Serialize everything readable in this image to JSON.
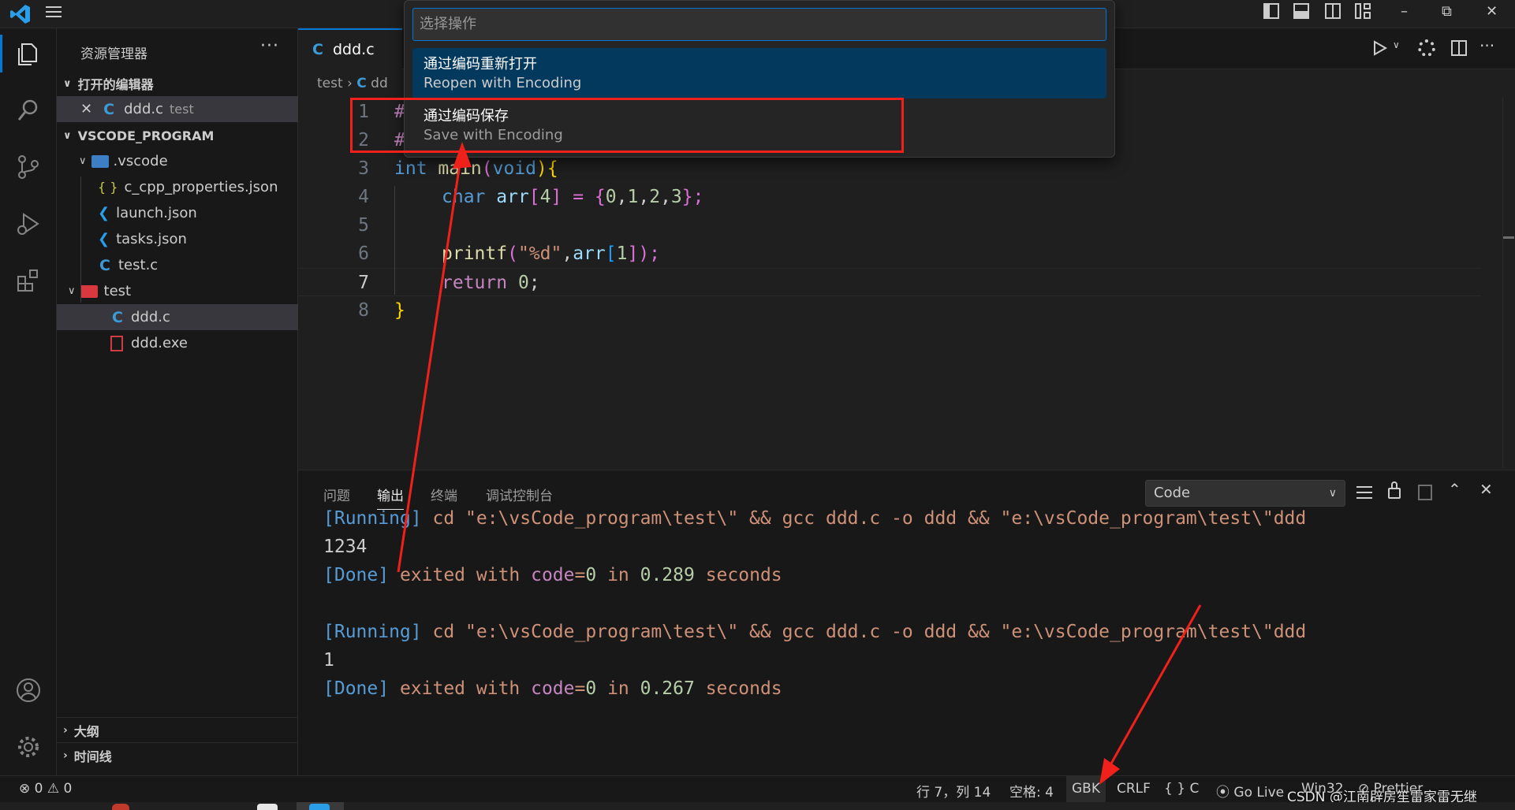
{
  "window": {
    "min_label": "–",
    "max_label": "⧉",
    "close_label": "✕"
  },
  "command_palette": {
    "placeholder": "选择操作",
    "items": [
      {
        "title": "通过编码重新打开",
        "subtitle": "Reopen with Encoding"
      },
      {
        "title": "通过编码保存",
        "subtitle": "Save with Encoding"
      }
    ]
  },
  "sidebar": {
    "title": "资源管理器",
    "more": "···",
    "open_editors_label": "打开的编辑器",
    "open_editor": {
      "name": "ddd.c",
      "folder": "test"
    },
    "workspace_label": "VSCODE_PROGRAM",
    "tree": [
      {
        "name": ".vscode",
        "type": "folder"
      },
      {
        "name": "c_cpp_properties.json",
        "type": "json"
      },
      {
        "name": "launch.json",
        "type": "vscode"
      },
      {
        "name": "tasks.json",
        "type": "vscode"
      },
      {
        "name": "test.c",
        "type": "c"
      },
      {
        "name": "test",
        "type": "folder"
      },
      {
        "name": "ddd.c",
        "type": "c"
      },
      {
        "name": "ddd.exe",
        "type": "exe"
      }
    ],
    "outline_label": "大纲",
    "timeline_label": "时间线"
  },
  "editor": {
    "tab_label": "ddd.c",
    "breadcrumb": [
      "test",
      "dd"
    ],
    "line_numbers": [
      "1",
      "2",
      "3",
      "4",
      "5",
      "6",
      "7",
      "8"
    ],
    "hidden_prefix": [
      "#",
      "#"
    ],
    "code": {
      "l3": [
        "int ",
        "main",
        "(",
        "void",
        "){"
      ],
      "l4": [
        "char ",
        "arr",
        "[",
        "4",
        "] = {",
        "0",
        ",",
        "1",
        ",",
        "2",
        ",",
        "3",
        "};"
      ],
      "l6": [
        "printf",
        "(",
        "\"%d\"",
        ",",
        "arr",
        "[",
        "1",
        "]);"
      ],
      "l7": [
        "return ",
        "0",
        ";"
      ],
      "l8": [
        "}"
      ]
    }
  },
  "panel": {
    "tabs": [
      "问题",
      "输出",
      "终端",
      "调试控制台"
    ],
    "active_tab": "输出",
    "channel": "Code",
    "output": [
      {
        "tag": "[Running]",
        "text": " cd \"e:\\vsCode_program\\test\\\" && gcc ddd.c -o ddd && \"e:\\vsCode_program\\test\\\"ddd"
      },
      {
        "plain": "1234"
      },
      {
        "tag": "[Done]",
        "pre": " exited with ",
        "kw": "code",
        "eq": "=",
        "num": "0",
        "mid": " in ",
        "time": "0.289",
        "post": " seconds"
      },
      {
        "tag": "[Running]",
        "text": " cd \"e:\\vsCode_program\\test\\\" && gcc ddd.c -o ddd && \"e:\\vsCode_program\\test\\\"ddd"
      },
      {
        "plain": "1"
      },
      {
        "tag": "[Done]",
        "pre": " exited with ",
        "kw": "code",
        "eq": "=",
        "num": "0",
        "mid": " in ",
        "time": "0.267",
        "post": " seconds"
      }
    ]
  },
  "status": {
    "errors": "0",
    "warnings": "0",
    "position": "行 7，列 14",
    "spaces": "空格: 4",
    "encoding": "GBK",
    "eol": "CRLF",
    "language": "C",
    "golive": "Go Live",
    "platform": "Win32",
    "prettier": "Prettier",
    "watermark": "CSDN @江南辟房笙雷家雷无继"
  },
  "colors": {
    "accent": "#0078d4",
    "annotation": "#f0201a",
    "keyword": "#569cd6",
    "string": "#ce9178",
    "number": "#b5cea8",
    "function": "#dcdcaa",
    "variable": "#9cdcfe"
  }
}
